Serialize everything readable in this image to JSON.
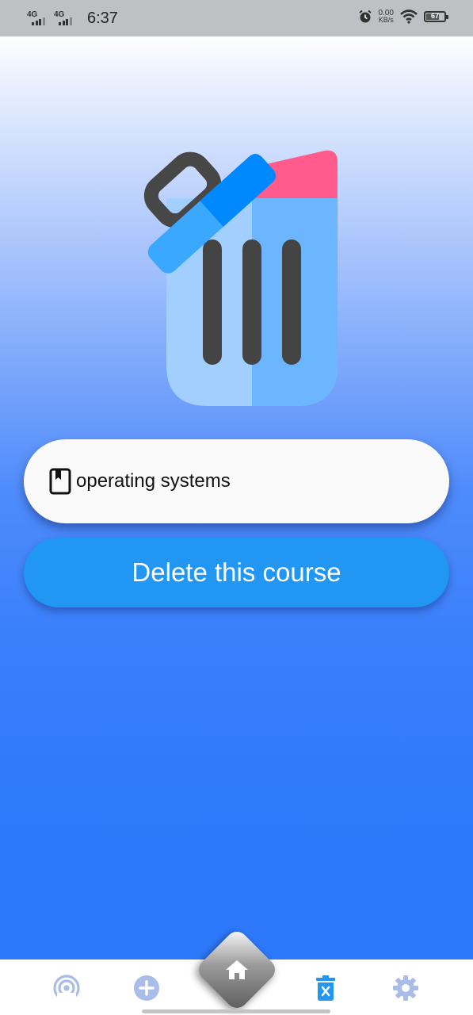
{
  "status_bar": {
    "network_1": "4G",
    "network_2": "4G",
    "time": "6:37",
    "speed_value": "0.00",
    "speed_unit": "KB/s",
    "battery_level": "67",
    "icons": [
      "signal-icon",
      "alarm-icon",
      "wifi-icon",
      "battery-icon"
    ]
  },
  "illustration": {
    "icon": "trash-can-icon",
    "colors": {
      "lid": "#3aa8ff",
      "lid_dark": "#0088ff",
      "body_light": "#a3cfff",
      "body": "#6cb6ff",
      "stripes": "#444444",
      "paper": "#ff5c8d"
    }
  },
  "course": {
    "icon": "book-icon",
    "name": "operating systems"
  },
  "delete_button": {
    "label": "Delete this course",
    "color": "#2196f3"
  },
  "bottom_nav": {
    "items": [
      {
        "icon": "broadcast-icon"
      },
      {
        "icon": "add-circle-icon"
      },
      {
        "icon": "home-icon",
        "active": true
      },
      {
        "icon": "delete-icon"
      },
      {
        "icon": "settings-icon"
      }
    ]
  }
}
